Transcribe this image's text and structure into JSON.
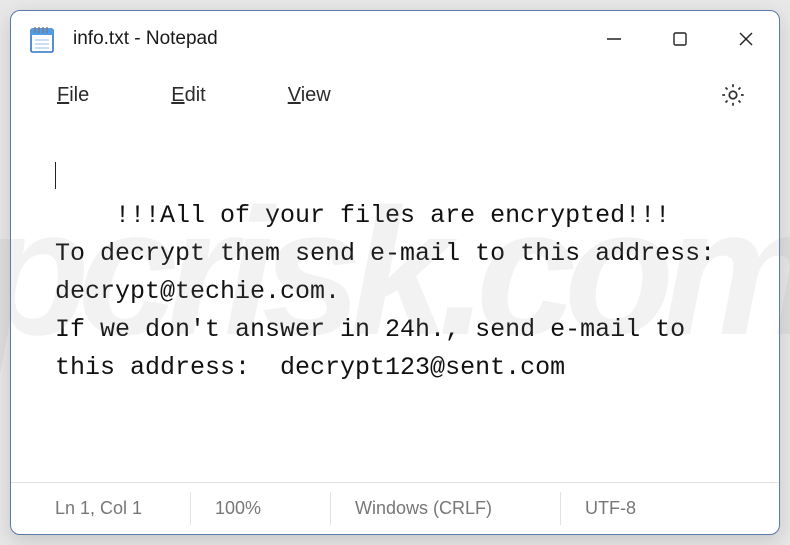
{
  "window": {
    "title": "info.txt - Notepad"
  },
  "menu": {
    "file": "File",
    "edit": "Edit",
    "view": "View"
  },
  "content": {
    "text": "!!!All of your files are encrypted!!!\nTo decrypt them send e-mail to this address: decrypt@techie.com.\nIf we don't answer in 24h., send e-mail to this address:  decrypt123@sent.com"
  },
  "status": {
    "position": "Ln 1, Col 1",
    "zoom": "100%",
    "eol": "Windows (CRLF)",
    "encoding": "UTF-8"
  },
  "watermark": "pcrisk.com"
}
